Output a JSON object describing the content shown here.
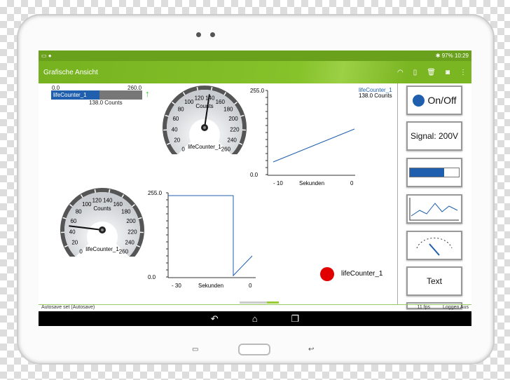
{
  "status": {
    "battery": "97%",
    "time": "10:29"
  },
  "appbar": {
    "title": "Grafische Ansicht",
    "icons": [
      "wifi-icon",
      "sd-card-icon",
      "trash-icon",
      "camera-icon",
      "more-vert-icon"
    ]
  },
  "bar": {
    "min": "0.0",
    "max": "260.0",
    "label": "lifeCounter_1",
    "value_text": "138.0 Counts",
    "fraction": 0.53,
    "color": "#1f5fad"
  },
  "gauge_top": {
    "unit": "Counts",
    "label": "lifeCounter_1",
    "ticks": [
      "0",
      "20",
      "40",
      "60",
      "80",
      "100",
      "120",
      "140",
      "160",
      "180",
      "200",
      "220",
      "240",
      "260"
    ],
    "value": 138
  },
  "gauge_bottom": {
    "unit": "Counts",
    "label": "lifeCounter_1",
    "ticks": [
      "0",
      "20",
      "40",
      "60",
      "80",
      "100",
      "120",
      "140",
      "160",
      "180",
      "200",
      "220",
      "240",
      "260"
    ],
    "value": 50
  },
  "chart_top": {
    "ymax": "255.0",
    "ymin": "0.0",
    "xticks": [
      "- 10",
      "0"
    ],
    "xlabel": "Sekunden",
    "legend": "lifeCounter_1",
    "legend_value": "138.0 Counts"
  },
  "chart_bottom": {
    "ymax": "255.0",
    "ymin": "0.0",
    "xticks": [
      "- 30",
      "0"
    ],
    "xlabel": "Sekunden"
  },
  "led": {
    "label": "lifeCounter_1",
    "color": "#e00000"
  },
  "palette": {
    "onoff": "On/Off",
    "signal": "Signal: 200V",
    "text": "Text"
  },
  "footer": {
    "left": "Autosave set (Autosave)",
    "fps": "11 fps",
    "log": "Loggen Aus"
  }
}
